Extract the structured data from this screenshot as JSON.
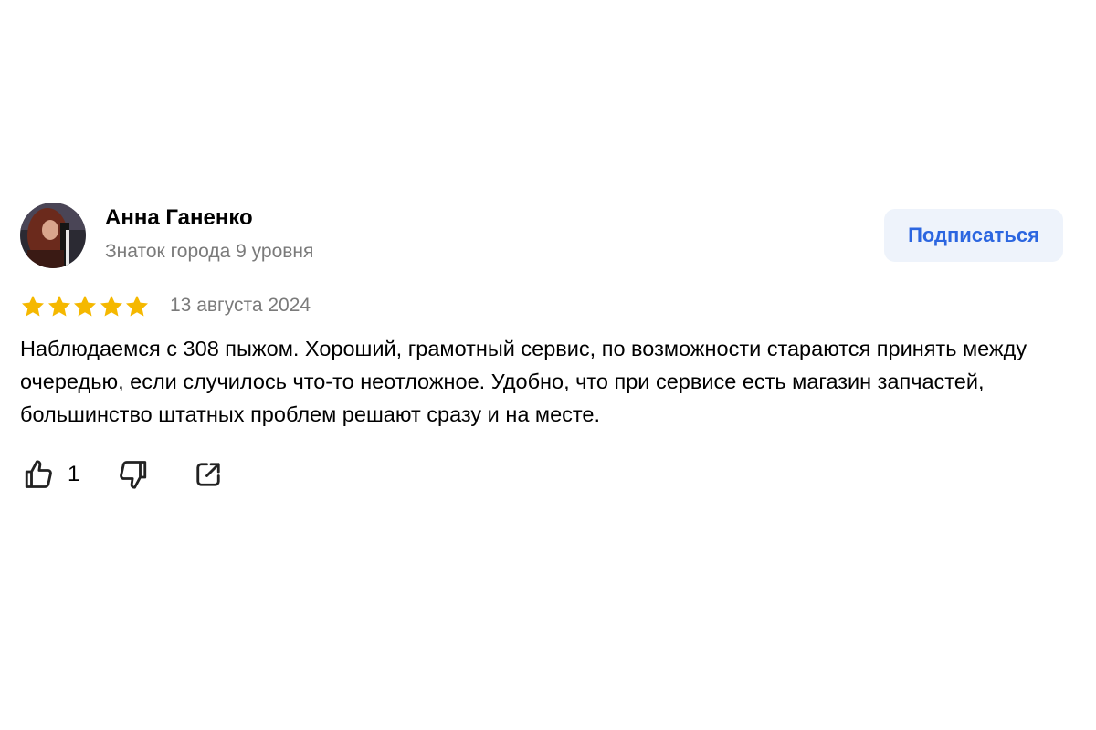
{
  "review": {
    "author": {
      "name": "Анна Ганенко",
      "level": "Знаток города 9 уровня"
    },
    "subscribe_label": "Подписаться",
    "rating": 5,
    "date": "13 августа 2024",
    "text": "Наблюдаемся с 308 пыжом. Хороший, грамотный сервис, по возможности стараются принять между очередью, если случилось что-то неотложное. Удобно, что при сервисе есть магазин запчастей, большинство штатных проблем решают сразу и на месте.",
    "likes": "1",
    "icons": {
      "like": "thumbs-up-icon",
      "dislike": "thumbs-down-icon",
      "share": "share-icon"
    }
  },
  "colors": {
    "star": "#f5b800",
    "accent": "#2c66e0",
    "button_bg": "#eef3fb",
    "muted_text": "#7a7a7a"
  }
}
